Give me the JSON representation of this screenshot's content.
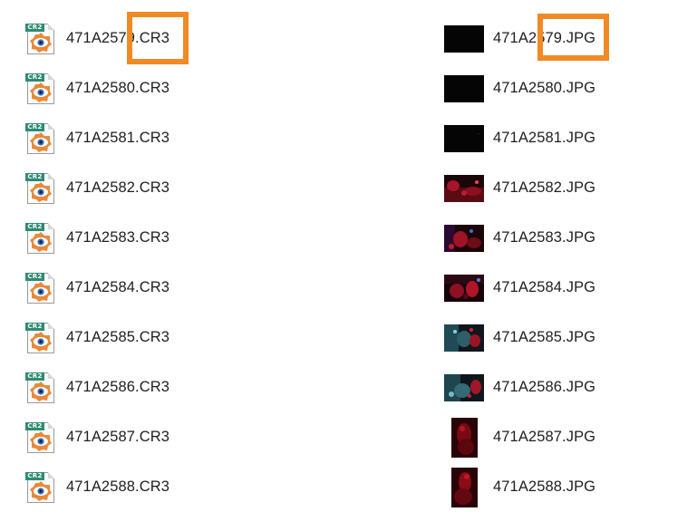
{
  "files_left": [
    {
      "name": "471A2579.CR3",
      "icon": "cr3-file-icon",
      "tag": "CR2"
    },
    {
      "name": "471A2580.CR3",
      "icon": "cr3-file-icon",
      "tag": "CR2"
    },
    {
      "name": "471A2581.CR3",
      "icon": "cr3-file-icon",
      "tag": "CR2"
    },
    {
      "name": "471A2582.CR3",
      "icon": "cr3-file-icon",
      "tag": "CR2"
    },
    {
      "name": "471A2583.CR3",
      "icon": "cr3-file-icon",
      "tag": "CR2"
    },
    {
      "name": "471A2584.CR3",
      "icon": "cr3-file-icon",
      "tag": "CR2"
    },
    {
      "name": "471A2585.CR3",
      "icon": "cr3-file-icon",
      "tag": "CR2"
    },
    {
      "name": "471A2586.CR3",
      "icon": "cr3-file-icon",
      "tag": "CR2"
    },
    {
      "name": "471A2587.CR3",
      "icon": "cr3-file-icon",
      "tag": "CR2"
    },
    {
      "name": "471A2588.CR3",
      "icon": "cr3-file-icon",
      "tag": "CR2"
    }
  ],
  "files_right": [
    {
      "name": "471A2579.JPG",
      "thumb": "black"
    },
    {
      "name": "471A2580.JPG",
      "thumb": "black"
    },
    {
      "name": "471A2581.JPG",
      "thumb": "black"
    },
    {
      "name": "471A2582.JPG",
      "thumb": "red-scene"
    },
    {
      "name": "471A2583.JPG",
      "thumb": "red-scene"
    },
    {
      "name": "471A2584.JPG",
      "thumb": "red-scene"
    },
    {
      "name": "471A2585.JPG",
      "thumb": "teal-red-scene"
    },
    {
      "name": "471A2586.JPG",
      "thumb": "teal-red-scene"
    },
    {
      "name": "471A2587.JPG",
      "thumb": "red-portrait"
    },
    {
      "name": "471A2588.JPG",
      "thumb": "red-portrait"
    }
  ],
  "colors": {
    "highlight": "#f08a24",
    "icon_tag": "#2e8b74",
    "text": "#1f1f1f"
  }
}
